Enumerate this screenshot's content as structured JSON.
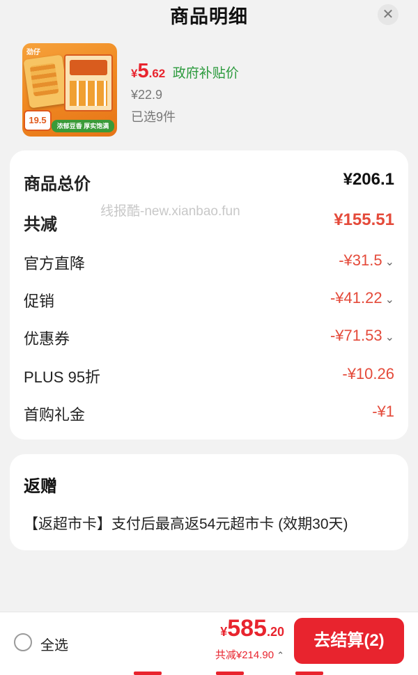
{
  "header": {
    "title": "商品明细",
    "close_glyph": "✕"
  },
  "product": {
    "brand_text": "劲仔",
    "badge_price": "19.5",
    "slogan": "浓郁豆香 厚实饱满",
    "price_symbol": "¥",
    "price_int": "5",
    "price_dec": ".62",
    "subsidy_label": "政府补贴价",
    "orig_price": "¥22.9",
    "selected_count": "已选9件"
  },
  "summary": {
    "watermark": "线报酷-new.xianbao.fun",
    "rows": [
      {
        "label": "商品总价",
        "value": "¥206.1"
      },
      {
        "label": "共减",
        "value": "¥155.51"
      },
      {
        "label": "官方直降",
        "value": "-¥31.5"
      },
      {
        "label": "促销",
        "value": "-¥41.22"
      },
      {
        "label": "优惠券",
        "value": "-¥71.53"
      },
      {
        "label": "PLUS 95折",
        "value": "-¥10.26"
      },
      {
        "label": "首购礼金",
        "value": "-¥1"
      }
    ]
  },
  "gift": {
    "title": "返赠",
    "text": "【返超市卡】支付后最高返54元超市卡 (效期30天)"
  },
  "bottom": {
    "select_all": "全选",
    "total_symbol": "¥",
    "total_int": "585",
    "total_dec": ".20",
    "reduce_text": "共减¥214.90",
    "checkout_label": "去结算(2)"
  },
  "colors": {
    "accent": "#e8242e",
    "discount": "#e44a3a",
    "subsidy_green": "#2a9a3c"
  },
  "icons": {
    "close": "close-icon",
    "chevron": "chevron-down-icon",
    "chevron_up": "chevron-up-icon",
    "radio": "radio-unchecked-icon"
  }
}
